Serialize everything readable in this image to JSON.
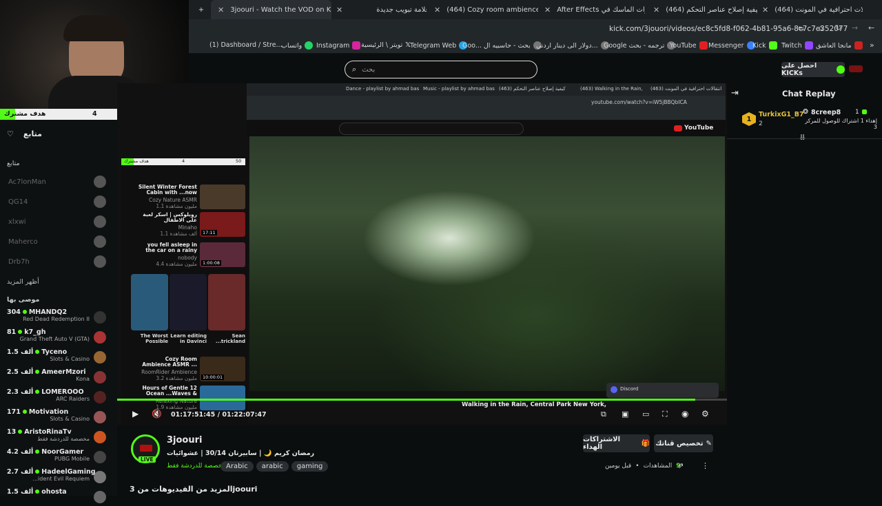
{
  "browser": {
    "tabs": [
      {
        "label": "3joouri - Watch the VOD on Ki",
        "icon": "kick"
      },
      {
        "label": "علامة تبويب جديدة",
        "icon": "chrome"
      },
      {
        "label": "(464) Cozy room ambience",
        "icon": "youtube"
      },
      {
        "label": "After Effects أدوات الماسك في",
        "icon": "youtube"
      },
      {
        "label": "(464) كيفية إصلاح عناصر التحكم",
        "icon": "youtube"
      },
      {
        "label": "(464) انتقالات احترافية في المونت",
        "icon": "youtube"
      }
    ],
    "url": "kick.com/3jouori/videos/ec8c5fd8-f062-4b81-95a6-8c7c7e352077",
    "bookmarks": [
      "(1) Dashboard / Stre...",
      "واتساب",
      "Instagram",
      "تويتر \\ الرئيسية",
      "Telegram Web",
      "Goo... بحث - حاسبيه ال",
      "دولار الى دينار اردني...",
      "Google ترجمه - بحث",
      "YouTube",
      "Messenger",
      "Kick",
      "Twitch",
      "مانجا العاشق"
    ]
  },
  "stream_overlay": {
    "goal_label": "هدف مشترك",
    "goal_current": "4",
    "goal_target": "50"
  },
  "header": {
    "search_placeholder": "بحث",
    "get_kicks": "احصل على KICKs"
  },
  "sidebar": {
    "following_title": "متابع",
    "following_label": "متابع",
    "followed": [
      {
        "name": "Ac7lonMan"
      },
      {
        "name": "QG14"
      },
      {
        "name": "xlxwi"
      },
      {
        "name": "Maherco"
      },
      {
        "name": "Drb7h"
      }
    ],
    "show_more": "أظهر المزيد",
    "recommended_title": "موصى بها",
    "recommended": [
      {
        "name": "MHANDQ2",
        "viewers": "304",
        "category": "Red Dead Redemption II"
      },
      {
        "name": "k7_gh",
        "viewers": "81",
        "category": "Grand Theft Auto V (GTA)"
      },
      {
        "name": "Tyceno",
        "viewers": "1.5 ألف",
        "category": "Slots & Casino"
      },
      {
        "name": "AmeerMzori",
        "viewers": "2.5 ألف",
        "category": "Kona"
      },
      {
        "name": "LOMEROOO",
        "viewers": "2.3 ألف",
        "category": "ARC Raiders"
      },
      {
        "name": "Motivation",
        "viewers": "171",
        "category": "Slots & Casino"
      },
      {
        "name": "AristoRinaTv",
        "viewers": "13",
        "category": "مخصصة للدردشة فقط"
      },
      {
        "name": "NoorGamer",
        "viewers": "4.2 ألف",
        "category": "PUBG Mobile"
      },
      {
        "name": "HadeelGaming",
        "viewers": "2.7 ألف",
        "category": "...ident Evil Requiem"
      },
      {
        "name": "ohosta",
        "viewers": "1.5 ألف",
        "category": ""
      }
    ]
  },
  "inner_screen": {
    "tabs": [
      "Dance - playlist by ahmad bas",
      "Music - playlist by ahmad bas",
      "(463) كيفية إصلاح عناصر التحكم",
      "(463) Walking in the Rain,",
      "(463) انتقالات احترافية في المونت"
    ],
    "url": "youtube.com/watch?v=iW5jBBQbICA",
    "youtube_logo": "YouTube",
    "list": [
      {
        "title": "Silent Winter Forest Cabin with ...now Outside and Soothing Fire",
        "channel": "Cozy Nature ASMR",
        "meta": "1.1 مليون مشاهدة"
      },
      {
        "title": "روبلوكس | اسكر لعبة على الاطفال",
        "channel": "Minaho",
        "meta": "1.1 ألف مشاهدة",
        "duration": "17:11"
      },
      {
        "title": "you fell asleep in the car on a rainy afternoon (playlist)",
        "channel": "nobody",
        "meta": "4.4 مليون مشاهدة",
        "duration": "1:00:08"
      },
      {
        "title": "Cozy Room Ambience ASMR ... Rain On Window Sounds With",
        "channel": "RoomRider Ambience",
        "meta": "3.2 مليون مشاهدة",
        "duration": "10:00:01"
      },
      {
        "title": "12 Hours of Gentle Ocean ...Waves & Seagull Sounds- 4K",
        "channel": "Relaxing Nature",
        "meta": "1.9 مليون مشاهدة"
      }
    ],
    "shorts": [
      {
        "title": "The Worst Possible"
      },
      {
        "title": "Learn editing in Davinci"
      },
      {
        "title": "Sean ...trickland vs"
      }
    ],
    "video_title": "Walking in the Rain, Central Park New York, Binaural Rai",
    "discord": "Discord"
  },
  "player": {
    "time_current": "01:17:51:45",
    "time_total": "01:22:07:47",
    "progress": 0.948
  },
  "chat": {
    "title": "Chat Replay",
    "message": {
      "user": "TurkixG1_B7",
      "badge_count": "2",
      "gifter": "8creep8",
      "text": "إهداء 1 اشتراك للوصول للمركز 3",
      "rank": "1"
    }
  },
  "channel": {
    "name": "3joouri",
    "live_badge": "LIVE",
    "title": "رمضان كريم 🌙 | سابيرتان 30/14 | عشوائيات",
    "category": "مخصصة للدردشة فقط",
    "tags": [
      "Arabic",
      "arabic",
      "gaming"
    ],
    "views_label": "المشاهدات",
    "views": "9",
    "age": "قبل يومين",
    "customize": "تخصيص قناتك",
    "gift_subs": "الاشتراكات الهداء",
    "more_videos": "المزيد من الفيديوهات من 3joouri"
  },
  "colors": {
    "accent": "#53fc18",
    "live": "#53fc18",
    "bg": "#0b0e0f"
  }
}
